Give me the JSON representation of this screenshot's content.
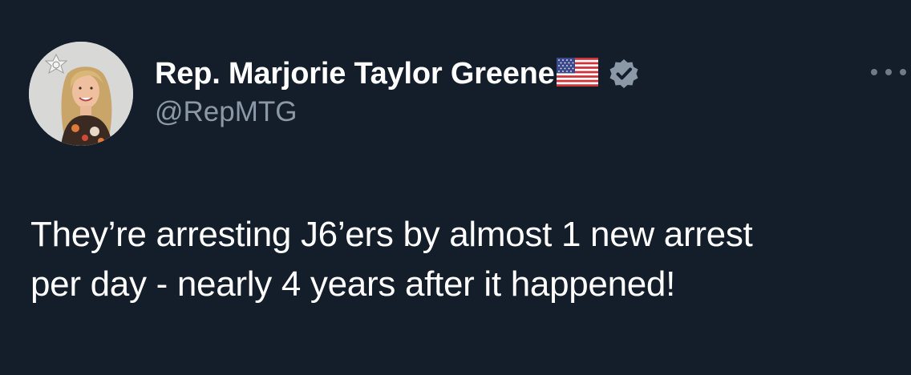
{
  "tweet": {
    "author": {
      "display_name": "Rep. Marjorie Taylor Greene",
      "handle": "@RepMTG",
      "verified": true,
      "name_emoji": "us-flag-icon"
    },
    "text_line1": "They’re arresting J6’ers by almost 1 new arrest",
    "text_line2": "per day - nearly 4 years after it happened!",
    "more_menu_icon": "more-options-icon"
  },
  "colors": {
    "background": "#141d2a",
    "primary_text": "#ffffff",
    "secondary_text": "#8b98a5",
    "verified_badge": "#8b98a5"
  }
}
